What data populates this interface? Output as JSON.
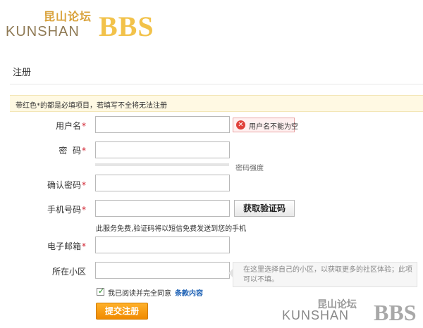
{
  "logo": {
    "cn": "昆山论坛",
    "en": "KUNSHAN",
    "bbs": "BBS"
  },
  "page": {
    "title": "注册"
  },
  "notice": {
    "text": "带红色*的都是必填项目，若填写不全将无法注册"
  },
  "form": {
    "required_mark": "*",
    "username": {
      "label": "用户名",
      "required": true,
      "value": "",
      "error": "用户名不能为空"
    },
    "password": {
      "label": "密  码",
      "required": true,
      "value": "",
      "strength_label": "密码强度"
    },
    "confirm_password": {
      "label": "确认密码",
      "required": true,
      "value": ""
    },
    "phone": {
      "label": "手机号码",
      "required": true,
      "value": "",
      "button": "获取验证码",
      "hint": "此服务免费,验证码将以短信免费发送到您的手机"
    },
    "email": {
      "label": "电子邮箱",
      "required": true,
      "value": ""
    },
    "community": {
      "label": "所在小区",
      "required": false,
      "value": "",
      "hint": "在这里选择自己的小区，以获取更多的社区体验；此项可以不填。"
    },
    "agreement": {
      "checked": true,
      "text": "我已阅读并完全同意",
      "link": "条款内容"
    },
    "submit": "提交注册"
  },
  "watermark": {
    "cn": "昆山论坛",
    "en": "KUNSHAN",
    "bbs": "BBS"
  },
  "colors": {
    "required": "#d0202e",
    "accent": "#f08a00",
    "link": "#1a5fb4",
    "notice_bg": "#fff9e3"
  },
  "icons": {
    "error": "error-circle-icon",
    "check": "checkmark-icon"
  }
}
